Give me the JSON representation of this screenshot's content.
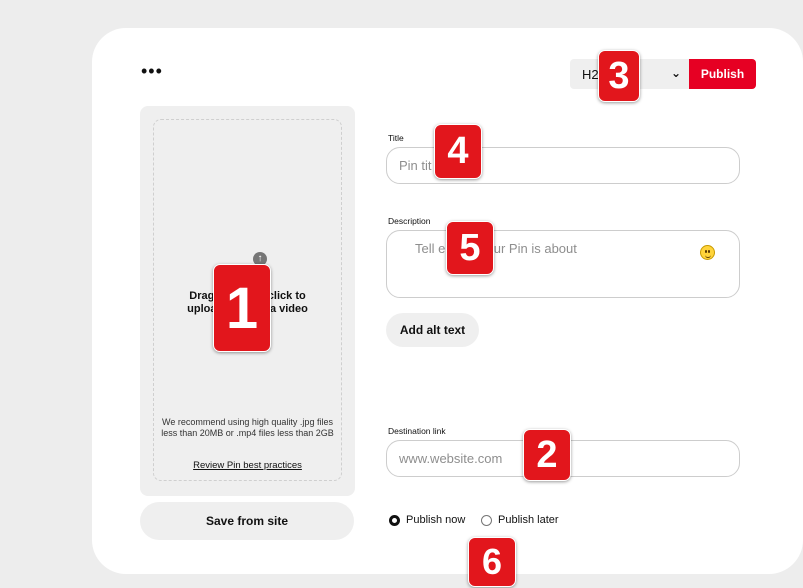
{
  "toolbar": {
    "more_icon": "more-icon",
    "board_select": "H2… ul…",
    "publish_label": "Publish"
  },
  "upload": {
    "upload_icon": "upload-arrow-icon",
    "line1": "Drag",
    "line1b": "r click to",
    "line2": "uploa",
    "line2b": "r a video",
    "recommendation": "We recommend using high quality .jpg files less than 20MB or .mp4 files less than 2GB",
    "review_link": "Review Pin best practices"
  },
  "save_from_site": "Save from site",
  "form": {
    "title_label": "Title",
    "title_placeholder": "Pin tit",
    "description_label": "Description",
    "description_placeholder": "Tell e what your Pin is about",
    "emoji_icon": "emoji-icon",
    "alt_text_button": "Add alt text",
    "destination_label": "Destination link",
    "destination_placeholder": "www.website.com"
  },
  "publish_options": {
    "now_label": "Publish now",
    "later_label": "Publish later",
    "selected": "now"
  },
  "badges": [
    "1",
    "2",
    "3",
    "4",
    "5",
    "6"
  ],
  "colors": {
    "accent": "#e60023",
    "badge": "#e2161c"
  }
}
